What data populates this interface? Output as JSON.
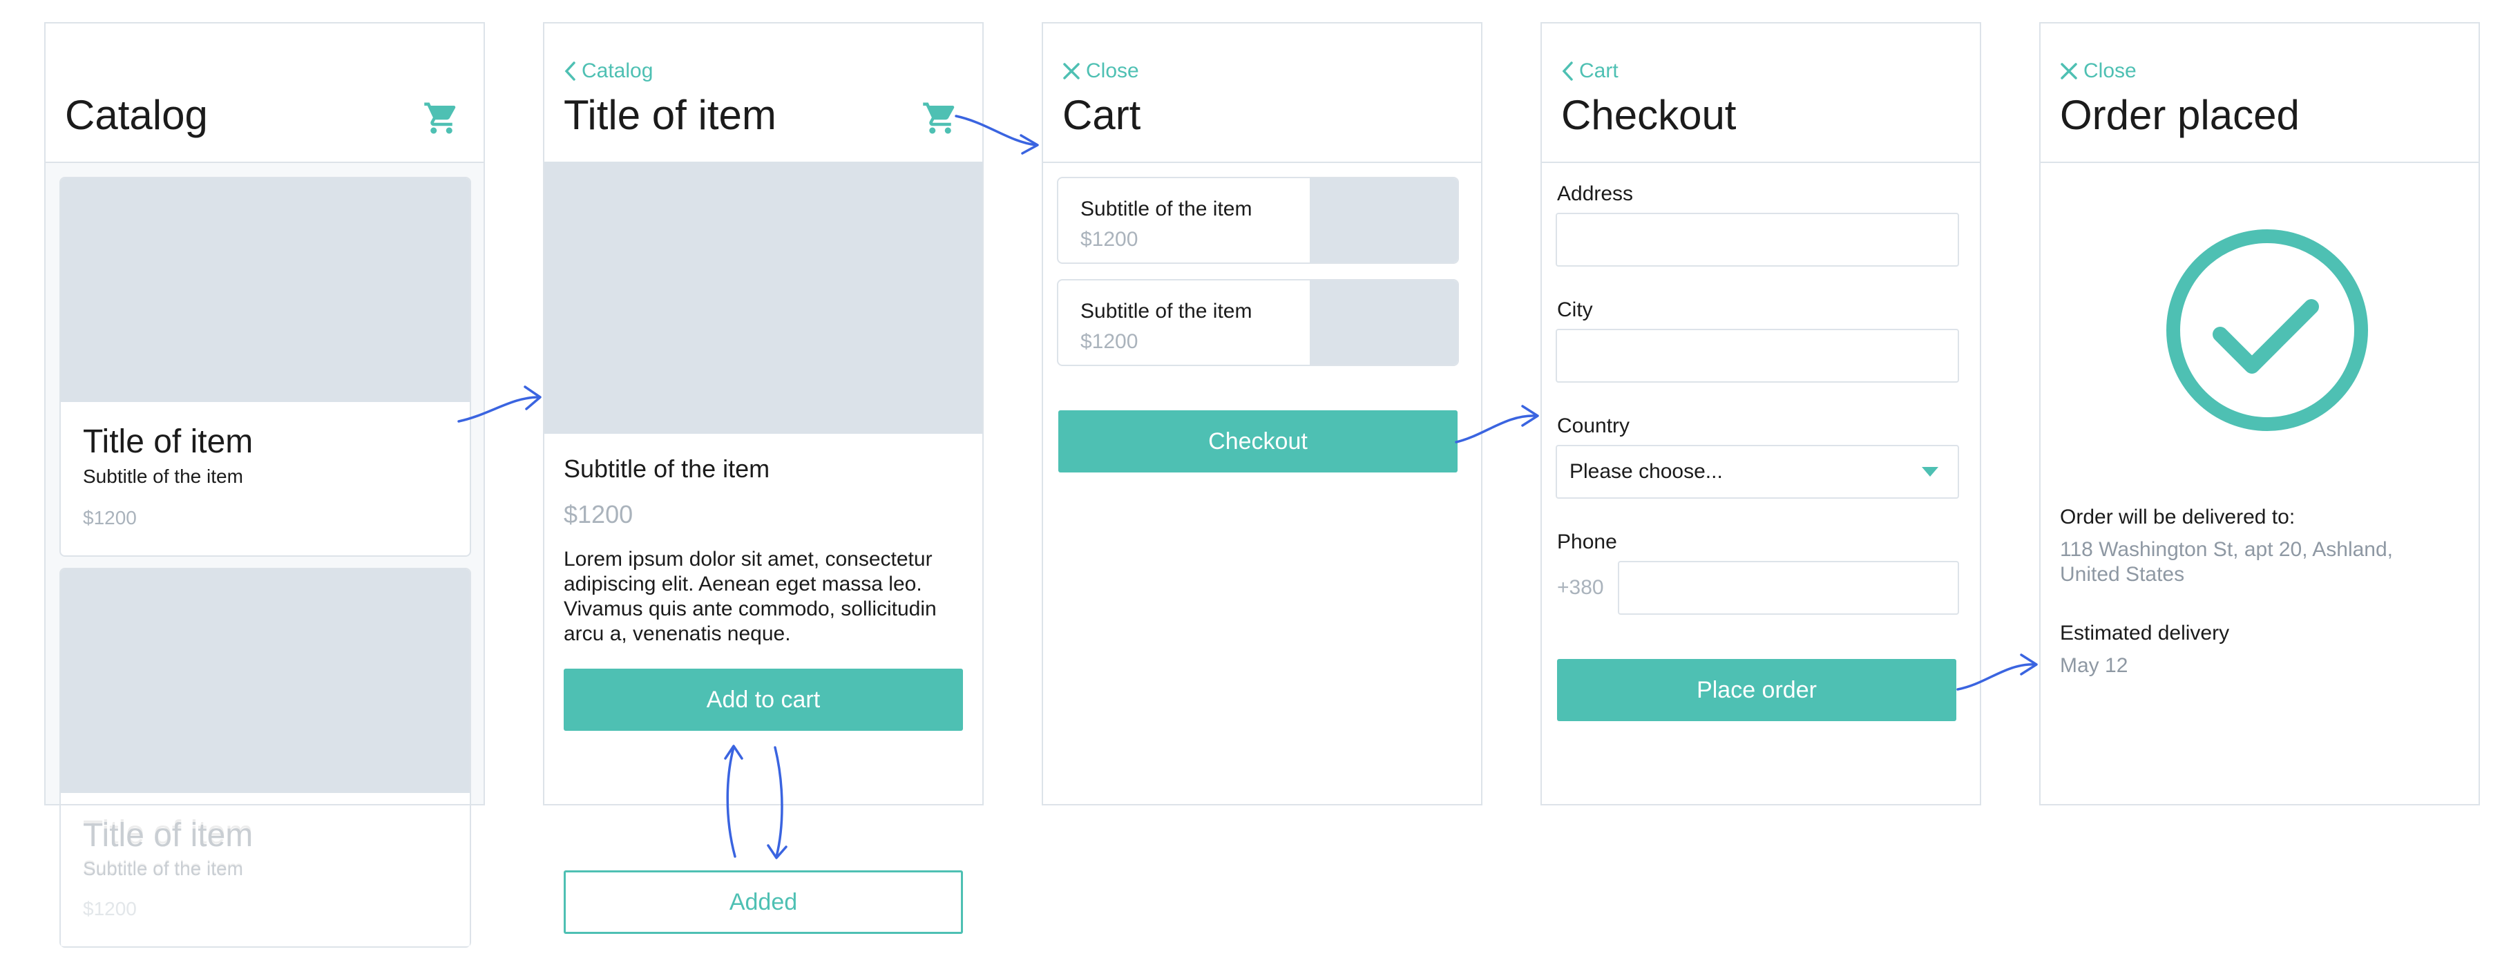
{
  "colors": {
    "accent": "#4ec0b3",
    "placeholder": "#dbe2e9",
    "border": "#dde3e9",
    "arrow": "#3a64e0"
  },
  "catalog": {
    "title": "Catalog",
    "cards": [
      {
        "title": "Title of item",
        "subtitle": "Subtitle of the item",
        "price": "$1200"
      },
      {
        "title": "Title of item",
        "subtitle": "Subtitle of the item",
        "price": "$1200"
      }
    ]
  },
  "item": {
    "back_label": "Catalog",
    "title": "Title of item",
    "subtitle": "Subtitle of the item",
    "price": "$1200",
    "description": "Lorem ipsum dolor sit amet, consectetur adipiscing elit. Aenean eget massa leo. Vivamus quis ante commodo, sollicitudin arcu a, venenatis neque.",
    "add_button": "Add to cart",
    "added_button": "Added"
  },
  "cart": {
    "close_label": "Close",
    "title": "Cart",
    "items": [
      {
        "name": "Subtitle of the item",
        "price": "$1200"
      },
      {
        "name": "Subtitle of the item",
        "price": "$1200"
      }
    ],
    "checkout_button": "Checkout"
  },
  "checkout": {
    "back_label": "Cart",
    "title": "Checkout",
    "address_label": "Address",
    "city_label": "City",
    "country_label": "Country",
    "country_value": "Please choose...",
    "phone_label": "Phone",
    "phone_prefix": "+380",
    "place_order_button": "Place order"
  },
  "order": {
    "close_label": "Close",
    "title": "Order placed",
    "delivered_label": "Order will be delivered to:",
    "address": "118 Washington St, apt 20, Ashland, United States",
    "estimated_label": "Estimated delivery",
    "estimated_date": "May 12"
  }
}
